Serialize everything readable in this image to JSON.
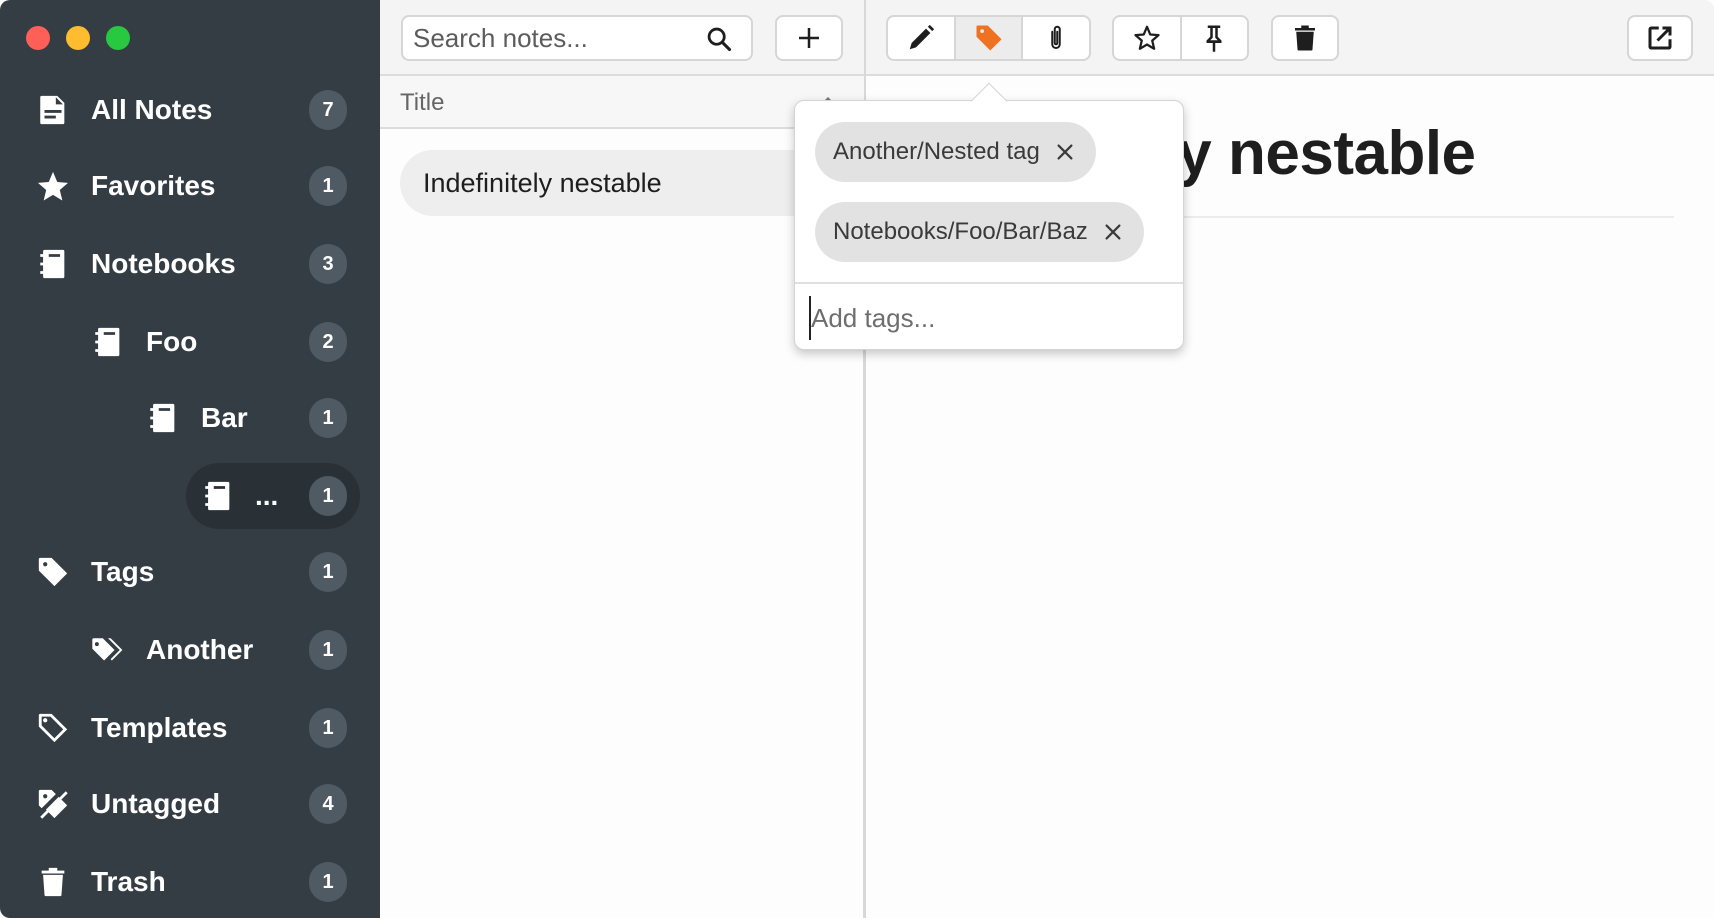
{
  "window": {
    "controls": [
      "close",
      "minimize",
      "maximize"
    ]
  },
  "sidebar": {
    "items": [
      {
        "label": "All Notes",
        "count": "7",
        "icon": "note-icon"
      },
      {
        "label": "Favorites",
        "count": "1",
        "icon": "star-icon"
      },
      {
        "label": "Notebooks",
        "count": "3",
        "icon": "notebook-icon"
      },
      {
        "label": "Foo",
        "count": "2",
        "icon": "notebook-icon"
      },
      {
        "label": "Bar",
        "count": "1",
        "icon": "notebook-icon"
      },
      {
        "label": "...",
        "count": "1",
        "icon": "notebook-icon",
        "active": true
      },
      {
        "label": "Tags",
        "count": "1",
        "icon": "tag-icon"
      },
      {
        "label": "Another",
        "count": "1",
        "icon": "tags-icon"
      },
      {
        "label": "Templates",
        "count": "1",
        "icon": "tag-outline-icon"
      },
      {
        "label": "Untagged",
        "count": "4",
        "icon": "tag-slash-icon"
      },
      {
        "label": "Trash",
        "count": "1",
        "icon": "trash-icon"
      }
    ]
  },
  "search": {
    "placeholder": "Search notes...",
    "value": ""
  },
  "list": {
    "column_header": "Title",
    "sort": "ascending",
    "notes": [
      {
        "title": "Indefinitely nestable",
        "selected": true
      }
    ]
  },
  "toolbar": {
    "buttons": [
      "new-note",
      "edit",
      "tags",
      "attachments",
      "favorite",
      "pin",
      "trash",
      "open-external"
    ],
    "active": "tags",
    "accent_color": "#ef7122"
  },
  "editor": {
    "title": "Indefinitely nestable"
  },
  "tag_popover": {
    "tags": [
      "Another/Nested tag",
      "Notebooks/Foo/Bar/Baz"
    ],
    "input_placeholder": "Add tags...",
    "input_value": ""
  }
}
